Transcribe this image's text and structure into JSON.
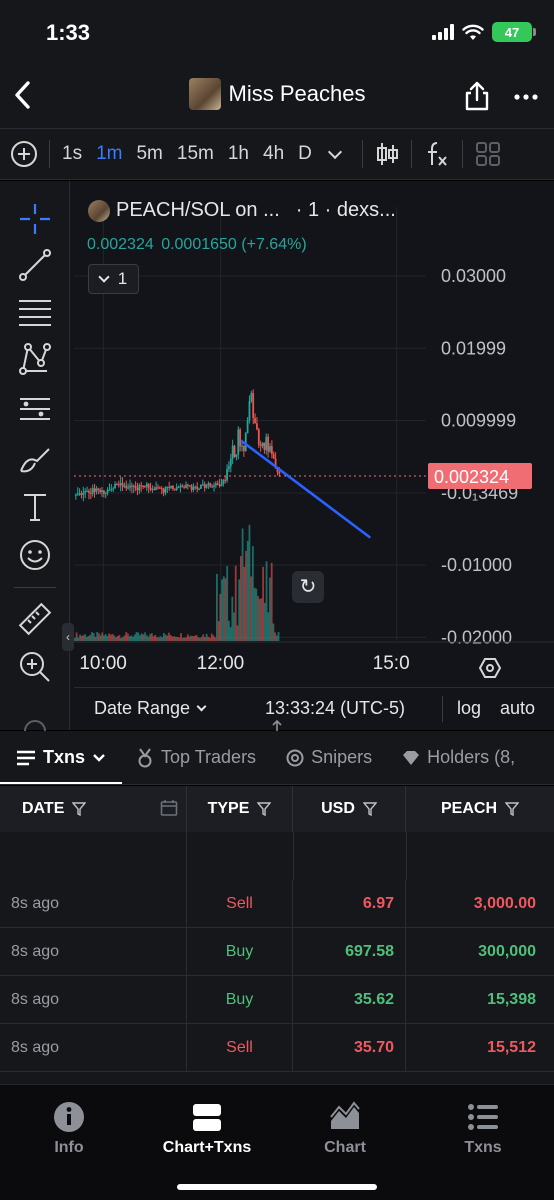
{
  "status_bar": {
    "time": "1:33",
    "battery": "47"
  },
  "nav": {
    "title": "Miss Peaches"
  },
  "toolbar": {
    "intervals": [
      {
        "label": "1s",
        "active": false
      },
      {
        "label": "1m",
        "active": true
      },
      {
        "label": "5m",
        "active": false
      },
      {
        "label": "15m",
        "active": false
      },
      {
        "label": "1h",
        "active": false
      },
      {
        "label": "4h",
        "active": false
      },
      {
        "label": "D",
        "active": false
      }
    ]
  },
  "chart_header": {
    "symbol": "PEACH/SOL on ...",
    "source": "· 1 · dexs...",
    "price": "0.002324",
    "change": "0.0001650",
    "change_pct": "(+7.64%)",
    "indicator_count": "1"
  },
  "chart_data": {
    "type": "candlestick",
    "title": "PEACH/SOL on ... · 1 · dexs...",
    "y_ticks": [
      "0.03000",
      "0.01999",
      "0.009999",
      "-0.0₁3469",
      "-0.01000",
      "-0.02000"
    ],
    "y_tick_values": [
      0.03,
      0.01999,
      0.009999,
      -3.469e-05,
      -0.01,
      -0.02
    ],
    "x_ticks": [
      "10:00",
      "12:00",
      "15:0"
    ],
    "last_price_label": "0.002324",
    "last_price": 0.002324,
    "ylim": [
      -0.0205,
      0.034
    ],
    "xlim_hours": [
      9.5,
      15.5
    ],
    "price_series": {
      "time": [
        9.5,
        9.75,
        10.0,
        10.25,
        10.5,
        10.75,
        11.0,
        11.25,
        11.5,
        11.75,
        12.0,
        12.1,
        12.2,
        12.3,
        12.4,
        12.5,
        12.6,
        12.7,
        12.8,
        12.9,
        13.0
      ],
      "price": [
        -0.0004,
        0.0003,
        0.0001,
        0.0014,
        0.0006,
        0.0009,
        0.0003,
        0.0008,
        0.0007,
        0.0009,
        0.0011,
        0.0023,
        0.005,
        0.0075,
        0.0064,
        0.0138,
        0.0089,
        0.0072,
        0.0062,
        0.0035,
        0.0023
      ]
    },
    "trendline": {
      "from": [
        12.35,
        0.0072
      ],
      "to": [
        14.55,
        -0.0062
      ],
      "color": "#2962ff"
    },
    "colors": {
      "up": "#26a69a",
      "down": "#ef5350",
      "price_label_bg": "#f06e73"
    },
    "grid": true,
    "volume_note": "volume bars shown below price"
  },
  "chart_footer": {
    "date_range": "Date Range",
    "clock": "13:33:24 (UTC-5)",
    "log": "log",
    "auto": "auto"
  },
  "tabs": [
    {
      "label": "Txns",
      "active": true
    },
    {
      "label": "Top Traders",
      "active": false
    },
    {
      "label": "Snipers",
      "active": false
    },
    {
      "label": "Holders (8,",
      "active": false
    }
  ],
  "table": {
    "headers": {
      "date": "DATE",
      "type": "TYPE",
      "usd": "USD",
      "token": "PEACH"
    },
    "rows": [
      {
        "date": "8s  ago",
        "type": "Sell",
        "usd": "6.97",
        "token": "3,000.00"
      },
      {
        "date": "8s  ago",
        "type": "Buy",
        "usd": "697.58",
        "token": "300,000"
      },
      {
        "date": "8s  ago",
        "type": "Buy",
        "usd": "35.62",
        "token": "15,398"
      },
      {
        "date": "8s  ago",
        "type": "Sell",
        "usd": "35.70",
        "token": "15,512"
      }
    ]
  },
  "bottom_tabs": [
    {
      "label": "Info",
      "icon": "info-icon",
      "active": false
    },
    {
      "label": "Chart+Txns",
      "icon": "split-view-icon",
      "active": true
    },
    {
      "label": "Chart",
      "icon": "area-chart-icon",
      "active": false
    },
    {
      "label": "Txns",
      "icon": "list-icon",
      "active": false
    }
  ]
}
